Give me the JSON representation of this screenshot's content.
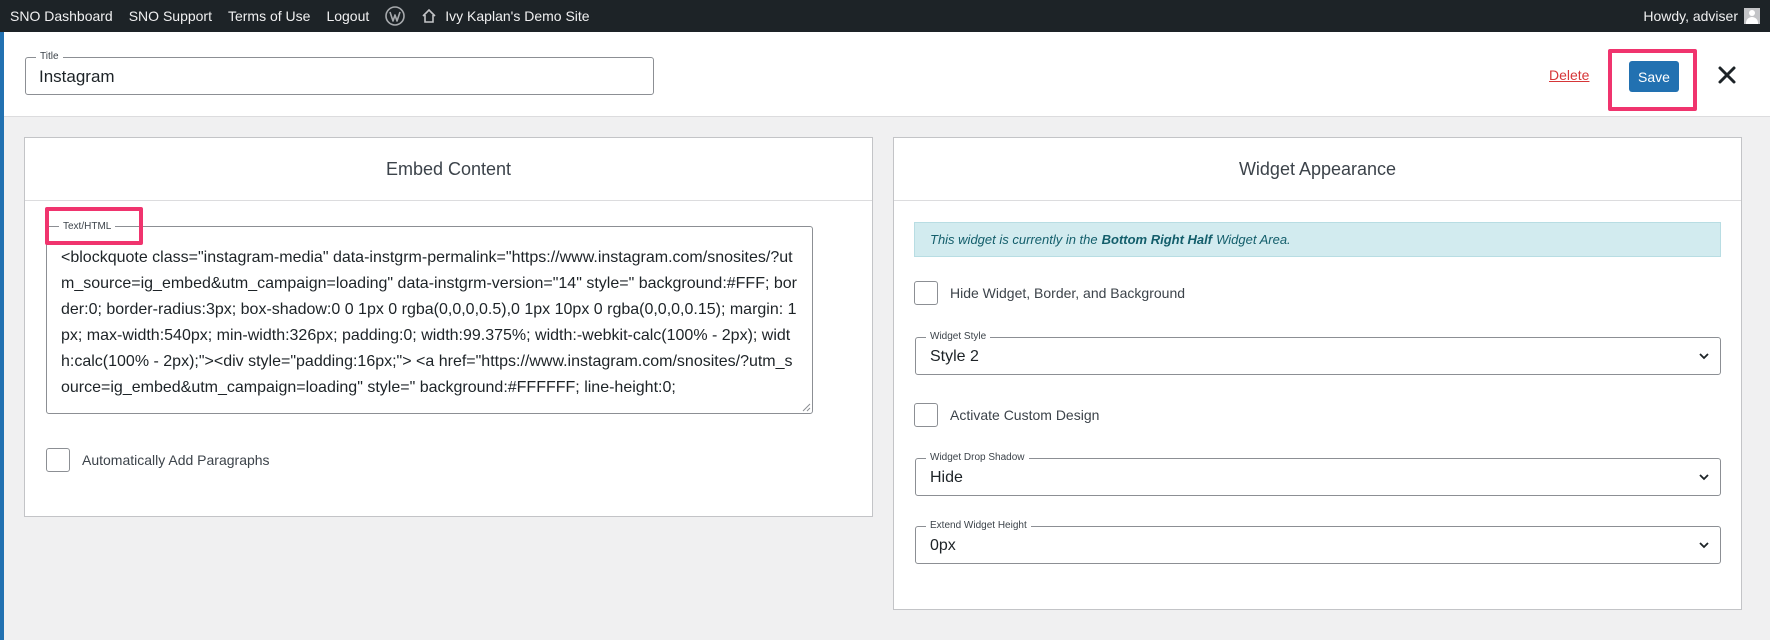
{
  "admin_bar": {
    "items": [
      "SNO Dashboard",
      "SNO Support",
      "Terms of Use",
      "Logout"
    ],
    "site_name": "Ivy Kaplan's Demo Site",
    "greeting": "Howdy, adviser"
  },
  "header": {
    "title_label": "Title",
    "title_value": "Instagram",
    "delete_label": "Delete",
    "save_label": "Save"
  },
  "embed": {
    "heading": "Embed Content",
    "textarea_label": "Text/HTML",
    "code": "<blockquote class=\"instagram-media\" data-instgrm-permalink=\"https://www.instagram.com/snosites/?utm_source=ig_embed&utm_campaign=loading\" data-instgrm-version=\"14\" style=\" background:#FFF; border:0; border-radius:3px; box-shadow:0 0 1px 0 rgba(0,0,0,0.5),0 1px 10px 0 rgba(0,0,0,0.15); margin: 1px; max-width:540px; min-width:326px; padding:0; width:99.375%; width:-webkit-calc(100% - 2px); width:calc(100% - 2px);\"><div style=\"padding:16px;\"> <a href=\"https://www.instagram.com/snosites/?utm_source=ig_embed&utm_campaign=loading\" style=\" background:#FFFFFF; line-height:0;",
    "auto_paragraphs_label": "Automatically Add Paragraphs"
  },
  "appearance": {
    "heading": "Widget Appearance",
    "notice_prefix": "This widget is currently in the",
    "notice_area": "Bottom Right Half",
    "notice_suffix": "Widget Area.",
    "hide_widget_label": "Hide Widget, Border, and Background",
    "widget_style_label": "Widget Style",
    "widget_style_value": "Style 2",
    "custom_design_label": "Activate Custom Design",
    "drop_shadow_label": "Widget Drop Shadow",
    "drop_shadow_value": "Hide",
    "extend_height_label": "Extend Widget Height",
    "extend_height_value": "0px"
  },
  "colors": {
    "accent": "#2271b1",
    "highlight": "#f0346e",
    "danger": "#d63638"
  }
}
